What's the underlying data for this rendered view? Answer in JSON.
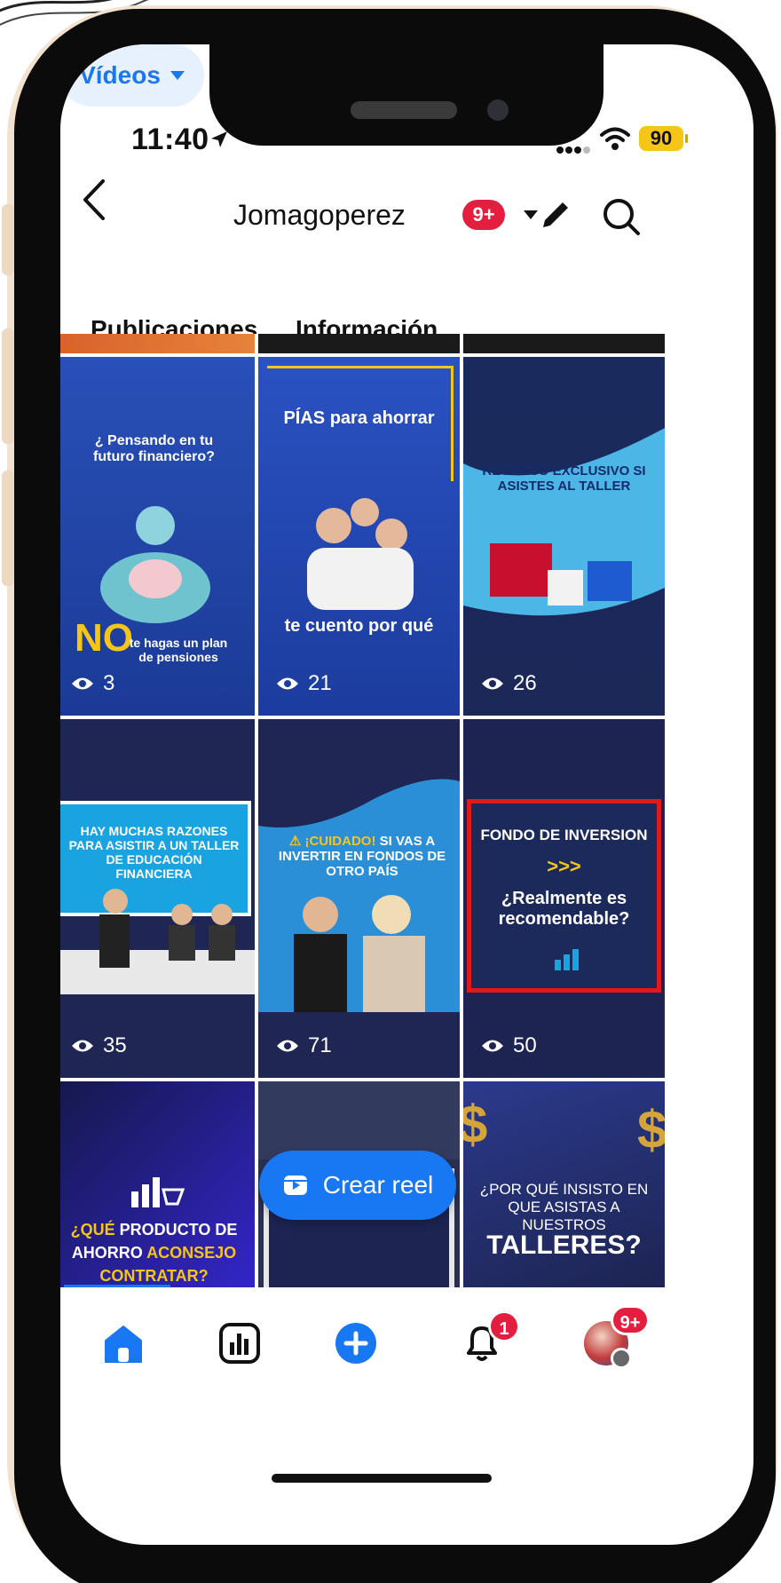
{
  "status_bar": {
    "time": "11:40",
    "battery": "90"
  },
  "header": {
    "page_name": "Jomagoperez",
    "notifications_badge": "9+"
  },
  "tabs": [
    {
      "label": "Publicaciones",
      "active": false
    },
    {
      "label": "Información",
      "active": false
    },
    {
      "label": "Vídeos",
      "active": true
    }
  ],
  "videos": [
    {
      "title": "¿ Pensando en tu futuro financiero?",
      "highlight": "NO",
      "subtitle": "te hagas un plan de pensiones",
      "views": "3"
    },
    {
      "title": "PÍAS para ahorrar",
      "subtitle": "te cuento por qué",
      "views": "21"
    },
    {
      "title": "RECURSO EXCLUSIVO SI ASISTES AL TALLER",
      "views": "26"
    },
    {
      "title": "HAY MUCHAS RAZONES PARA ASISTIR A UN TALLER DE EDUCACIÓN FINANCIERA",
      "views": "35"
    },
    {
      "highlight": "¡CUIDADO!",
      "title": "SI VAS A INVERTIR EN FONDOS DE OTRO PAÍS",
      "views": "71"
    },
    {
      "title": "FONDO DE INVERSION",
      "subtitle": "¿Realmente es recomendable?",
      "views": "50"
    },
    {
      "highlight": "¿QUÉ",
      "title": "PRODUCTO DE AHORRO",
      "highlight2": "ACONSEJO CONTRATAR?"
    },
    {},
    {
      "title": "¿POR QUÉ INSISTO EN QUE ASISTAS A NUESTROS",
      "subtitle": "TALLERES?"
    }
  ],
  "create_reel": {
    "label": "Crear reel"
  },
  "bottom_nav": {
    "notifications_count": "1",
    "profile_badge": "9+"
  },
  "colors": {
    "accent": "#1877f2",
    "badge": "#e41e3f",
    "tile_bg": "#1e2452",
    "yellow": "#f5c518",
    "red_frame": "#e01919"
  }
}
